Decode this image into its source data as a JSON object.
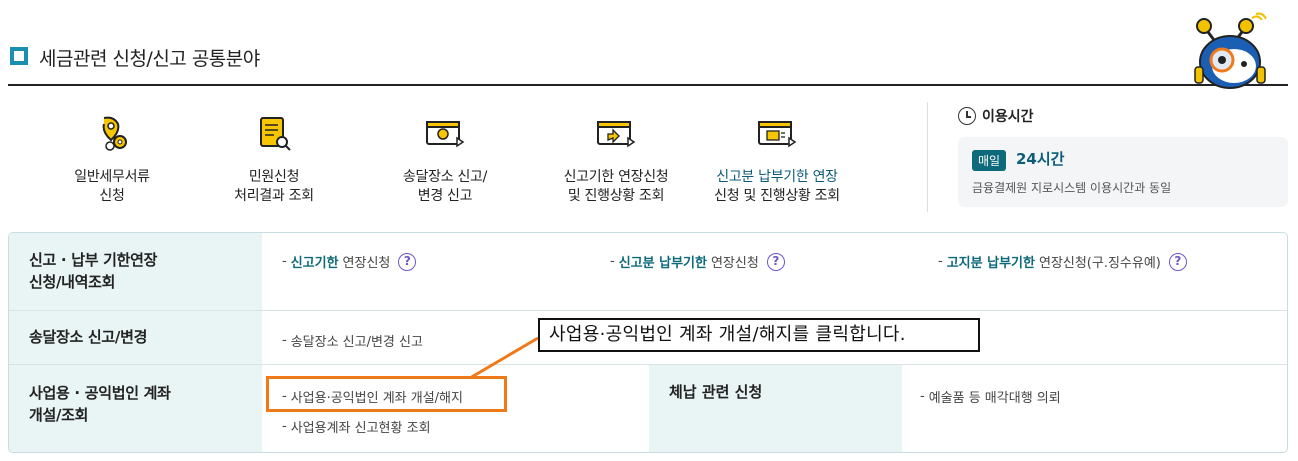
{
  "header": {
    "title": "세금관련 신청/신고 공통분야"
  },
  "menu": [
    {
      "line1": "일반세무서류",
      "line2": "신청",
      "icon": "document-gear-icon"
    },
    {
      "line1": "민원신청",
      "line2": "처리결과 조회",
      "icon": "scroll-search-icon"
    },
    {
      "line1": "송달장소 신고/",
      "line2": "변경 신고",
      "icon": "mail-location-icon"
    },
    {
      "line1": "신고기한 연장신청",
      "line2": "및 진행상황 조회",
      "icon": "clock-extend-icon"
    },
    {
      "line1": "신고분 납부기한 연장",
      "line2": "신청 및 진행상황 조회",
      "icon": "payment-extend-icon"
    }
  ],
  "usage": {
    "title": "이용시간",
    "badge": "매일",
    "hours": "24시간",
    "note": "금융결제원 지로시스템 이용시간과 동일"
  },
  "table": {
    "row1": {
      "header_line1": "신고 · 납부 기한연장",
      "header_line2": "신청/내역조회",
      "links": [
        {
          "highlight": "신고기한",
          "rest": "연장신청"
        },
        {
          "highlight": "신고분 납부기한",
          "rest": "연장신청"
        },
        {
          "highlight": "고지분 납부기한",
          "rest": "연장신청(구.징수유예)"
        }
      ]
    },
    "row2": {
      "header": "송달장소 신고/변경",
      "link": "송달장소 신고/변경 신고"
    },
    "row3": {
      "header_line1": "사업용 · 공익법인 계좌",
      "header_line2": "개설/조회",
      "links": [
        "사업용·공익법인 계좌 개설/해지",
        "사업용계좌 신고현황 조회"
      ],
      "header2": "체납 관련 신청",
      "link2": "예술품 등 매각대행 의뢰"
    }
  },
  "callout": "사업용·공익법인 계좌 개설/해지를 클릭합니다.",
  "colors": {
    "accent": "#0d6a7a",
    "highlight_box": "#f07a1a",
    "row_header_bg": "#e9f4f4"
  }
}
